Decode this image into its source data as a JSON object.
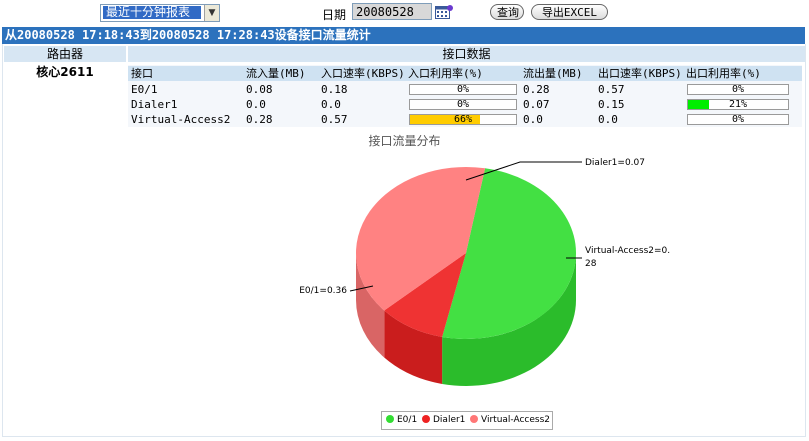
{
  "toolbar": {
    "report_select": "最近十分钟报表",
    "date_label": "日期",
    "date_value": "20080528",
    "query_label": "查询",
    "export_label": "导出EXCEL"
  },
  "title": "从20080528 17:18:43到20080528 17:28:43设备接口流量统计",
  "header": {
    "router": "路由器",
    "iface_data": "接口数据"
  },
  "router_name": "核心2611",
  "table": {
    "columns": [
      "接口",
      "流入量(MB)",
      "入口速率(KBPS)",
      "入口利用率(%)",
      "流出量(MB)",
      "出口速率(KBPS)",
      "出口利用率(%)"
    ],
    "rows": [
      {
        "iface": "E0/1",
        "in_mb": "0.08",
        "in_rate": "0.18",
        "in_util": 0,
        "in_util_text": "0%",
        "out_mb": "0.28",
        "out_rate": "0.57",
        "out_util": 0,
        "out_util_text": "0%"
      },
      {
        "iface": "Dialer1",
        "in_mb": "0.0",
        "in_rate": "0.0",
        "in_util": 0,
        "in_util_text": "0%",
        "out_mb": "0.07",
        "out_rate": "0.15",
        "out_util": 21,
        "out_util_text": "21%"
      },
      {
        "iface": "Virtual-Access2",
        "in_mb": "0.28",
        "in_rate": "0.57",
        "in_util": 66,
        "in_util_text": "66%",
        "out_mb": "0.0",
        "out_rate": "0.0",
        "out_util": 0,
        "out_util_text": "0%"
      }
    ]
  },
  "chart_data": {
    "type": "pie",
    "title": "接口流量分布",
    "slices": [
      {
        "name": "E0/1",
        "value": 0.36,
        "label": "E0/1=0.36",
        "color": "#33dd33"
      },
      {
        "name": "Dialer1",
        "value": 0.07,
        "label": "Dialer1=0.07",
        "color": "#ee2222"
      },
      {
        "name": "Virtual-Access2",
        "value": 0.28,
        "label_line1": "Virtual-Access2=0.",
        "label_line2": "28",
        "color": "#ff7777"
      }
    ],
    "legend": [
      "E0/1",
      "Dialer1",
      "Virtual-Access2"
    ],
    "legend_position": "bottom"
  },
  "colors": {
    "title_bar": "#2c72bd",
    "header_bg": "#d7e6f3",
    "in_util_bar": "#ffcc00",
    "out_util_bar": "#00ee00"
  }
}
